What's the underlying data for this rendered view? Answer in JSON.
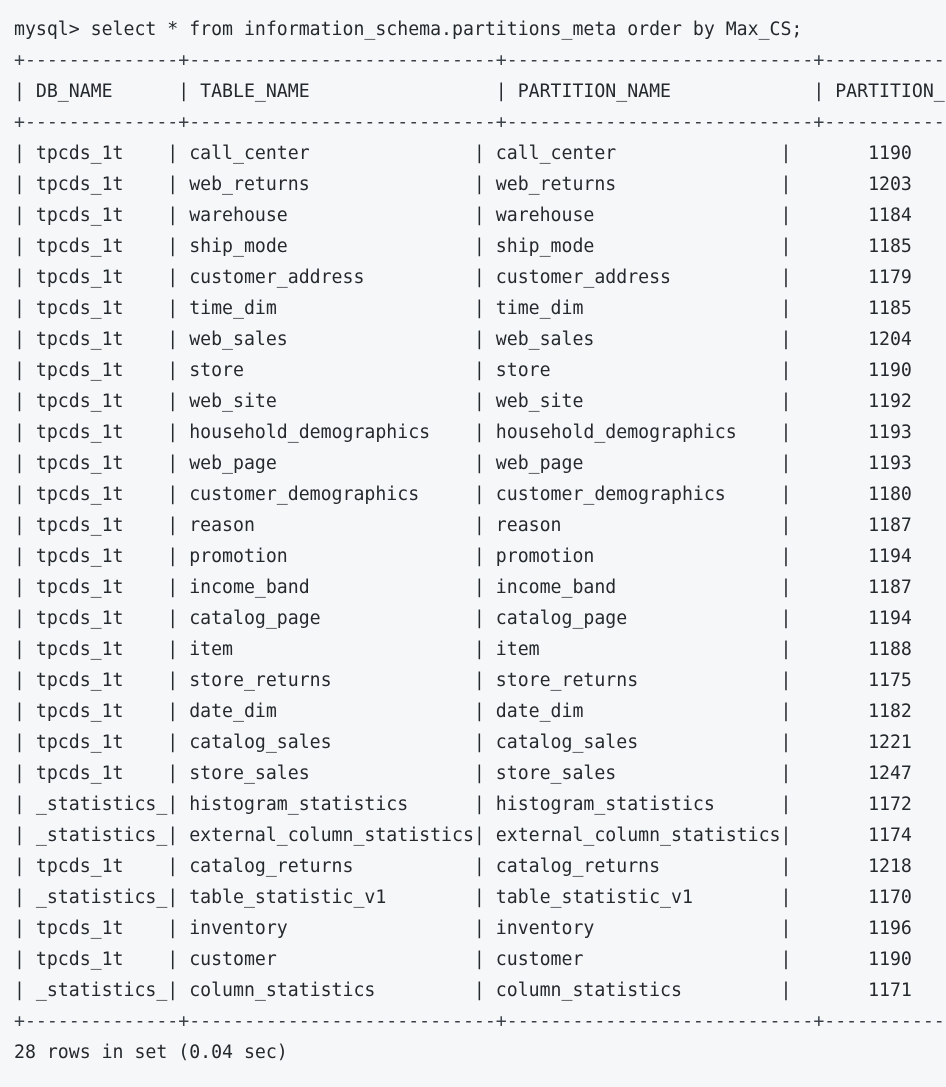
{
  "terminal": {
    "prompt": "mysql>",
    "command": "select * from information_schema.partitions_meta order by Max_CS;",
    "prompt_line": "mysql> select * from information_schema.partitions_meta order by Max_CS;",
    "footer": "28 rows in set (0.04 sec)",
    "row_count": 28,
    "elapsed": "0.04 sec",
    "background_color": "#f6f7f9",
    "text_color": "#24292e"
  },
  "table": {
    "separator": "+--------------+----------------------------+----------------------------+------------",
    "header_line": "| DB_NAME      | TABLE_NAME                 | PARTITION_NAME             | PARTITION_I",
    "columns": [
      {
        "name": "DB_NAME",
        "width": 14,
        "align": "left"
      },
      {
        "name": "TABLE_NAME",
        "width": 28,
        "align": "left"
      },
      {
        "name": "PARTITION_NAME",
        "width": 28,
        "align": "left"
      },
      {
        "name": "PARTITION_I",
        "width": 12,
        "align": "right",
        "truncated": true
      }
    ],
    "rows": [
      {
        "db_name": "tpcds_1t",
        "table_name": "call_center",
        "partition_name": "call_center",
        "partition_id": "1190"
      },
      {
        "db_name": "tpcds_1t",
        "table_name": "web_returns",
        "partition_name": "web_returns",
        "partition_id": "1203"
      },
      {
        "db_name": "tpcds_1t",
        "table_name": "warehouse",
        "partition_name": "warehouse",
        "partition_id": "1184"
      },
      {
        "db_name": "tpcds_1t",
        "table_name": "ship_mode",
        "partition_name": "ship_mode",
        "partition_id": "1185"
      },
      {
        "db_name": "tpcds_1t",
        "table_name": "customer_address",
        "partition_name": "customer_address",
        "partition_id": "1179"
      },
      {
        "db_name": "tpcds_1t",
        "table_name": "time_dim",
        "partition_name": "time_dim",
        "partition_id": "1185"
      },
      {
        "db_name": "tpcds_1t",
        "table_name": "web_sales",
        "partition_name": "web_sales",
        "partition_id": "1204"
      },
      {
        "db_name": "tpcds_1t",
        "table_name": "store",
        "partition_name": "store",
        "partition_id": "1190"
      },
      {
        "db_name": "tpcds_1t",
        "table_name": "web_site",
        "partition_name": "web_site",
        "partition_id": "1192"
      },
      {
        "db_name": "tpcds_1t",
        "table_name": "household_demographics",
        "partition_name": "household_demographics",
        "partition_id": "1193"
      },
      {
        "db_name": "tpcds_1t",
        "table_name": "web_page",
        "partition_name": "web_page",
        "partition_id": "1193"
      },
      {
        "db_name": "tpcds_1t",
        "table_name": "customer_demographics",
        "partition_name": "customer_demographics",
        "partition_id": "1180"
      },
      {
        "db_name": "tpcds_1t",
        "table_name": "reason",
        "partition_name": "reason",
        "partition_id": "1187"
      },
      {
        "db_name": "tpcds_1t",
        "table_name": "promotion",
        "partition_name": "promotion",
        "partition_id": "1194"
      },
      {
        "db_name": "tpcds_1t",
        "table_name": "income_band",
        "partition_name": "income_band",
        "partition_id": "1187"
      },
      {
        "db_name": "tpcds_1t",
        "table_name": "catalog_page",
        "partition_name": "catalog_page",
        "partition_id": "1194"
      },
      {
        "db_name": "tpcds_1t",
        "table_name": "item",
        "partition_name": "item",
        "partition_id": "1188"
      },
      {
        "db_name": "tpcds_1t",
        "table_name": "store_returns",
        "partition_name": "store_returns",
        "partition_id": "1175"
      },
      {
        "db_name": "tpcds_1t",
        "table_name": "date_dim",
        "partition_name": "date_dim",
        "partition_id": "1182"
      },
      {
        "db_name": "tpcds_1t",
        "table_name": "catalog_sales",
        "partition_name": "catalog_sales",
        "partition_id": "1221"
      },
      {
        "db_name": "tpcds_1t",
        "table_name": "store_sales",
        "partition_name": "store_sales",
        "partition_id": "1247"
      },
      {
        "db_name": "_statistics_",
        "table_name": "histogram_statistics",
        "partition_name": "histogram_statistics",
        "partition_id": "1172"
      },
      {
        "db_name": "_statistics_",
        "table_name": "external_column_statistics",
        "partition_name": "external_column_statistics",
        "partition_id": "1174"
      },
      {
        "db_name": "tpcds_1t",
        "table_name": "catalog_returns",
        "partition_name": "catalog_returns",
        "partition_id": "1218"
      },
      {
        "db_name": "_statistics_",
        "table_name": "table_statistic_v1",
        "partition_name": "table_statistic_v1",
        "partition_id": "1170"
      },
      {
        "db_name": "tpcds_1t",
        "table_name": "inventory",
        "partition_name": "inventory",
        "partition_id": "1196"
      },
      {
        "db_name": "tpcds_1t",
        "table_name": "customer",
        "partition_name": "customer",
        "partition_id": "1190"
      },
      {
        "db_name": "_statistics_",
        "table_name": "column_statistics",
        "partition_name": "column_statistics",
        "partition_id": "1171"
      }
    ]
  }
}
